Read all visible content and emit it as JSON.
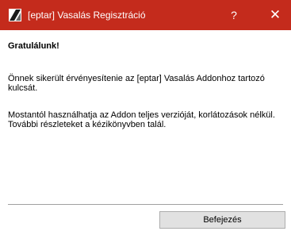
{
  "window": {
    "title": "[eptar] Vasalás Regisztráció",
    "help_label": "?",
    "close_label": "✕",
    "titlebar_color": "#c42b1c",
    "icon": "app-icon"
  },
  "content": {
    "heading": "Gratulálunk!",
    "paragraph1": "Önnek sikerült érvényesítenie az [eptar] Vasalás Addonhoz tartozó kulcsát.",
    "paragraph2": "Mostantól használhatja az Addon teljes verzióját, korlátozások nélkül. További részleteket a kézikönyvben talál."
  },
  "buttons": {
    "finish_label": "Befejezés"
  }
}
